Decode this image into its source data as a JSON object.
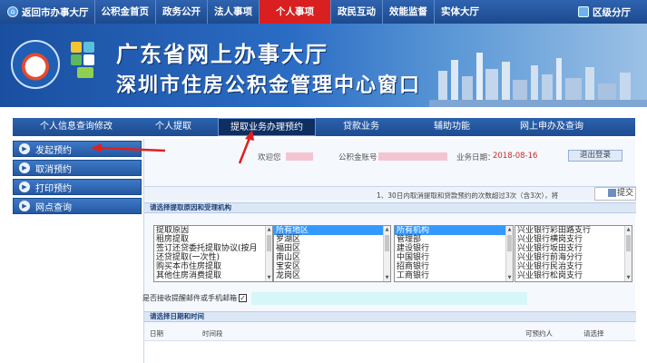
{
  "topnav": {
    "back_label": "返回市办事大厅",
    "items": [
      "公积金首页",
      "政务公开",
      "法人事项",
      "个人事项",
      "政民互动",
      "效能监督",
      "实体大厅"
    ],
    "active_index": 3,
    "district_label": "区级分厅"
  },
  "banner": {
    "title_line1": "广东省网上办事大厅",
    "title_line2": "深圳市住房公积金管理中心窗口"
  },
  "subnav": {
    "items": [
      "个人信息查询修改",
      "个人提取",
      "提取业务办理预约",
      "贷款业务",
      "辅助功能",
      "网上申办及查询"
    ],
    "active_index": 2
  },
  "leftmenu": {
    "items": [
      "发起预约",
      "取消预约",
      "打印预约",
      "网点查询"
    ]
  },
  "userbar": {
    "welcome_label": "欢迎您",
    "account_label": "公积金账号",
    "business_date_label": "业务日期：",
    "business_date": "2018-08-16",
    "logout_label": "退出登录"
  },
  "notice": {
    "text": "1、30日内取消提取和贷款预约的次数超过3次（含3次），将",
    "submit_label": "提交"
  },
  "section1": {
    "title": "请选择提取原因和受理机构"
  },
  "listboxes": {
    "reasons": [
      "提取原因",
      "租房提取",
      "签订还贷委托提取协议(按月",
      "还贷提取(一次性)",
      "购买本市住房提取",
      "其他住房消费提取"
    ],
    "districts": [
      "所有地区",
      "罗湖区",
      "福田区",
      "南山区",
      "宝安区",
      "龙岗区"
    ],
    "institutions": [
      "所有机构",
      "管理部",
      "建设银行",
      "中国银行",
      "招商银行",
      "工商银行"
    ],
    "branches": [
      "兴业银行彩田路支行",
      "兴业银行横岗支行",
      "兴业银行坂田支行",
      "兴业银行前海分行",
      "兴业银行民治支行",
      "兴业银行松岗支行"
    ]
  },
  "email_row": {
    "label": "是否接收提醒邮件或手机邮箱",
    "checked_mark": "✓"
  },
  "section2": {
    "title": "请选择日期和时间"
  },
  "table": {
    "columns": [
      "日期",
      "时间段",
      "可预约人",
      "请选择"
    ]
  },
  "colors": {
    "nav_blue": "#1c4a8e",
    "active_red": "#d91f1f",
    "selection_blue": "#3399ff",
    "annotation_red": "#e02020",
    "date_red": "#cc2a2a"
  }
}
